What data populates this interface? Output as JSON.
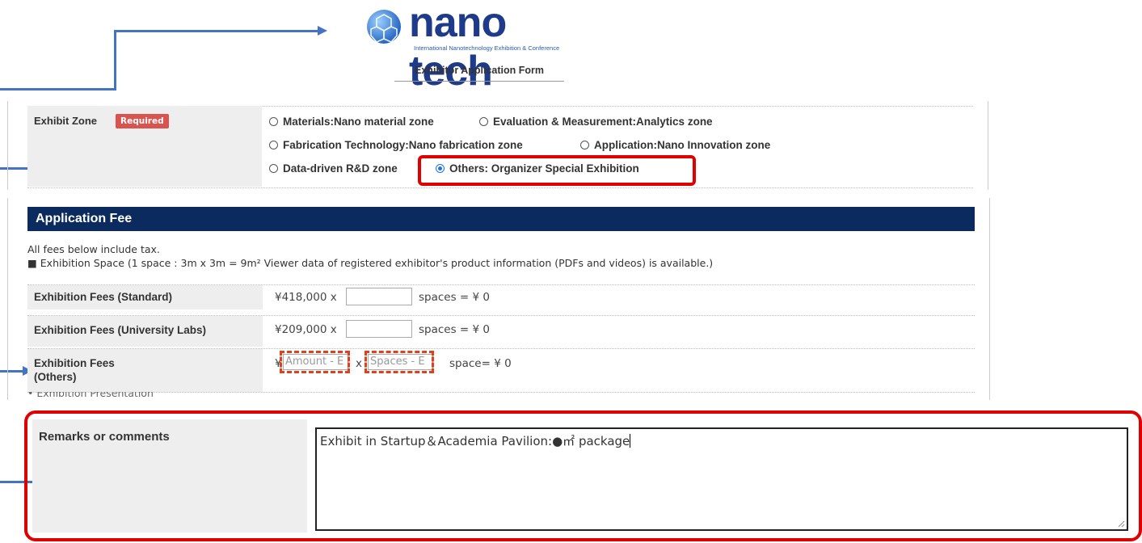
{
  "header": {
    "logo_text": "nano tech",
    "logo_tagline": "International Nanotechnology Exhibition & Conference",
    "form_title": "Exhibitor Application Form"
  },
  "zone": {
    "label": "Exhibit Zone",
    "required_badge": "Required",
    "options": [
      "Materials:Nano material zone",
      "Evaluation & Measurement:Analytics zone",
      "Fabrication Technology:Nano fabrication zone",
      "Application:Nano Innovation zone",
      "Data-driven R&D zone",
      "Others: Organizer Special Exhibition"
    ],
    "selected": "Others: Organizer Special Exhibition"
  },
  "fee": {
    "header": "Application Fee",
    "note_tax": "All fees below include tax.",
    "note_space": "■ Exhibition Space (1 space : 3m x 3m = 9m² Viewer data of registered exhibitor's product information (PDFs and videos) is available.)",
    "rows": [
      {
        "label": "Exhibition Fees (Standard)",
        "price": "¥418,000 x",
        "suffix": "spaces = ¥ 0"
      },
      {
        "label": "Exhibition Fees (University Labs)",
        "price": "¥209,000 x",
        "suffix": "spaces = ¥ 0"
      },
      {
        "label_line1": "Exhibition Fees",
        "label_line2": "(Others)",
        "prefix": "¥",
        "amount_placeholder": "Amount - E",
        "times": "x",
        "spaces_placeholder": "Spaces - E",
        "suffix": "space= ¥ 0"
      }
    ],
    "partial_next": "• Exhibition Presentation"
  },
  "remarks": {
    "label": "Remarks or comments",
    "value": "Exhibit in Startup＆Academia Pavilion:●㎡ package"
  },
  "colors": {
    "navy": "#0b2a5e",
    "required_red": "#d9534f",
    "highlight_red": "#e00000",
    "connector_blue": "#4472c4",
    "radio_blue": "#1a73e8"
  }
}
